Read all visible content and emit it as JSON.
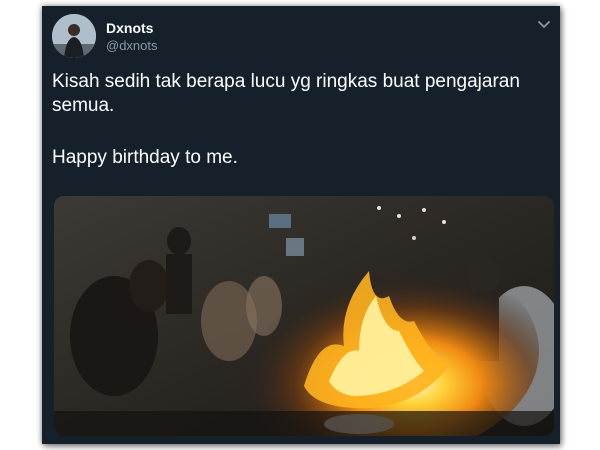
{
  "tweet": {
    "author": {
      "display_name": "Dxnots",
      "handle": "@dxnots",
      "avatar_icon": "profile-photo"
    },
    "menu_icon": "chevron-down-icon",
    "text_lines": [
      "Kisah sedih tak berapa lucu yg ringkas buat pengajaran",
      "semua.",
      "",
      "Happy birthday to me."
    ],
    "media": {
      "type": "video-thumbnail",
      "description_icon": "fire-flames-image"
    }
  },
  "colors": {
    "card_background": "#15202b",
    "text_primary": "#ffffff",
    "text_secondary": "#8899a6"
  }
}
